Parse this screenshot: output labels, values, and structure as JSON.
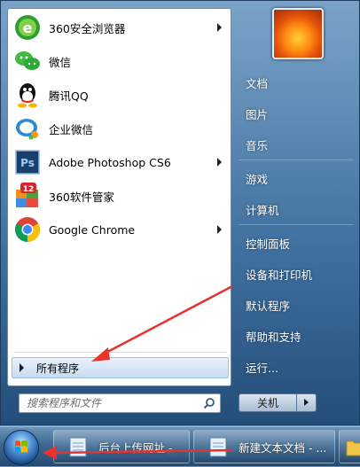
{
  "programs": [
    {
      "label": "360安全浏览器",
      "icon": "360-browser-icon",
      "has_submenu": true
    },
    {
      "label": "微信",
      "icon": "wechat-icon",
      "has_submenu": false
    },
    {
      "label": "腾讯QQ",
      "icon": "qq-icon",
      "has_submenu": false
    },
    {
      "label": "企业微信",
      "icon": "wecom-icon",
      "has_submenu": false
    },
    {
      "label": "Adobe Photoshop CS6",
      "icon": "photoshop-icon",
      "has_submenu": true
    },
    {
      "label": "360软件管家",
      "icon": "360-software-manager-icon",
      "badge": "12",
      "has_submenu": false
    },
    {
      "label": "Google Chrome",
      "icon": "chrome-icon",
      "has_submenu": true
    }
  ],
  "all_programs_label": "所有程序",
  "search": {
    "placeholder": "搜索程序和文件"
  },
  "right_pane": {
    "items": [
      "文档",
      "图片",
      "音乐",
      "游戏",
      "计算机",
      "控制面板",
      "设备和打印机",
      "默认程序",
      "帮助和支持",
      "运行..."
    ]
  },
  "shutdown_label": "关机",
  "taskbar": {
    "buttons": [
      {
        "label": "后台上传网址 - ..."
      },
      {
        "label": "新建文本文档 - ..."
      }
    ]
  },
  "colors": {
    "annotation_arrow": "#e8322e",
    "ps_blue": "#1b3f6b",
    "chrome_red": "#db4437"
  }
}
